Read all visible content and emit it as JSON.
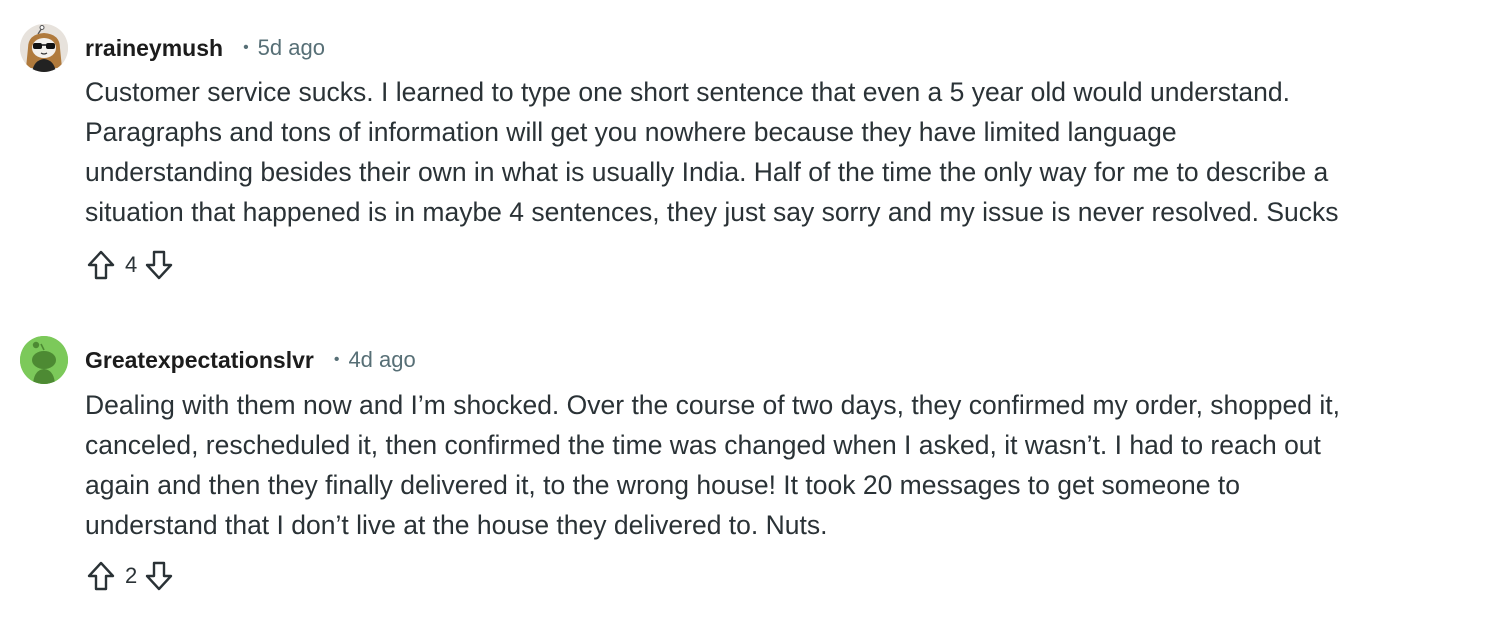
{
  "comments": [
    {
      "username": "rraineymush",
      "separator": "•",
      "time": "5d ago",
      "lines": [
        "Customer service sucks. I learned to type one short sentence that even a 5 year old would understand.",
        "Paragraphs and tons of information will get you nowhere because they have limited language",
        "understanding besides their own in what is usually India. Half of the time the only way for me to describe a",
        "situation that happened is in maybe 4 sentences, they just say sorry and my issue is never resolved. Sucks"
      ],
      "score": "4",
      "avatar_icon": "avatar-sunglasses-icon"
    },
    {
      "username": "Greatexpectationslvr",
      "separator": "•",
      "time": "4d ago",
      "lines": [
        "Dealing with them now and I’m shocked. Over the course of two days, they confirmed my order, shopped it,",
        "canceled, rescheduled it, then confirmed the time was changed when I asked, it wasn’t. I had to reach out",
        "again and then they finally delivered it, to the wrong house! It took 20 messages to get someone to",
        "understand that I don’t live at the house they delivered to. Nuts."
      ],
      "score": "2",
      "avatar_icon": "avatar-snoo-icon"
    }
  ],
  "icons": {
    "upvote": "upvote-arrow-icon",
    "downvote": "downvote-arrow-icon"
  },
  "colors": {
    "avatar_green": "#7cc95a",
    "meta_gray": "#576f76",
    "text": "#2a3236"
  }
}
